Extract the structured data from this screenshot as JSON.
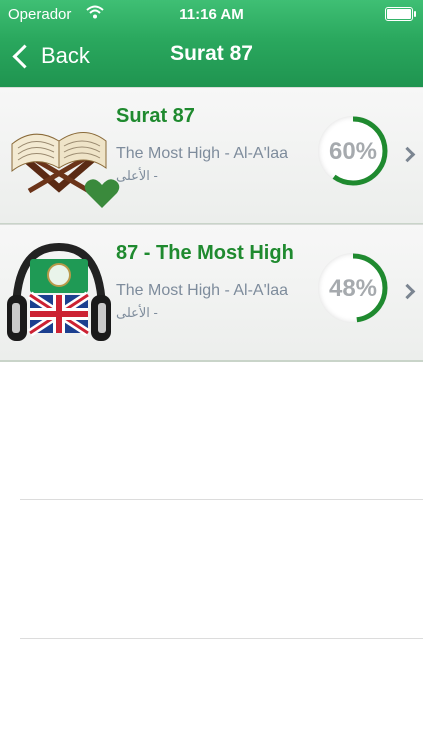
{
  "status": {
    "carrier": "Operador",
    "time": "11:16 AM"
  },
  "nav": {
    "back_label": "Back",
    "title": "Surat 87"
  },
  "rows": [
    {
      "title": "Surat 87",
      "subtitle": "The Most High - Al-A'laa",
      "arabic": "الأعلى -",
      "percent": 60,
      "percent_label": "60%"
    },
    {
      "title": "87 - The Most High",
      "subtitle": "The Most High - Al-A'laa",
      "arabic": "الأعلى -",
      "percent": 48,
      "percent_label": "48%"
    }
  ],
  "colors": {
    "accent_green": "#1f8a2f",
    "bar_green": "#2aa85e",
    "progress_green": "#1f8a2f"
  },
  "icons": [
    "wifi-icon",
    "battery-icon",
    "chevron-left-icon",
    "quran-book-icon",
    "heart-icon",
    "headphones-flag-icon",
    "chevron-right-icon"
  ]
}
